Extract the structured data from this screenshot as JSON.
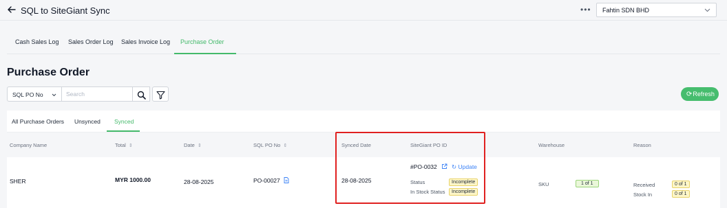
{
  "header": {
    "title": "SQL to SiteGiant Sync",
    "more_label": "•••",
    "company": "Fahtin SDN BHD"
  },
  "main_tabs": [
    {
      "label": "Cash Sales Log",
      "active": false
    },
    {
      "label": "Sales Order Log",
      "active": false
    },
    {
      "label": "Sales Invoice Log",
      "active": false
    },
    {
      "label": "Purchase Order",
      "active": true
    }
  ],
  "page_title": "Purchase Order",
  "search": {
    "filter_field": "SQL PO No",
    "placeholder": "Search"
  },
  "refresh_label": "Refresh",
  "sub_tabs": [
    {
      "label": "All Purchase Orders",
      "active": false
    },
    {
      "label": "Unsynced",
      "active": false
    },
    {
      "label": "Synced",
      "active": true
    }
  ],
  "table": {
    "headers": {
      "company_name": "Company Name",
      "total": "Total",
      "date": "Date",
      "sql_po_no": "SQL PO No",
      "synced_date": "Synced Date",
      "sitegiant_po_id": "SiteGiant PO ID",
      "warehouse": "Warehouse",
      "reason": "Reason"
    },
    "rows": [
      {
        "company_name": "SHER",
        "total": "MYR 1000.00",
        "date": "28-08-2025",
        "sql_po_no": "PO-00027",
        "synced_date": "28-08-2025",
        "sitegiant_po_id": "#PO-0032",
        "update_label": "Update",
        "status_label": "Status",
        "status_value": "Incomplete",
        "stock_status_label": "In Stock Status",
        "stock_status_value": "Incomplete",
        "warehouse_label": "SKU",
        "warehouse_value": "1 of 1",
        "received_label": "Received",
        "received_value": "0 of 1",
        "stock_in_label": "Stock In",
        "stock_in_value": "0 of 1"
      }
    ]
  },
  "colors": {
    "accent_green": "#43b96a",
    "highlight_red": "#e0201f",
    "link_blue": "#3b82f6",
    "badge_yellow": "#fdf6c8"
  }
}
